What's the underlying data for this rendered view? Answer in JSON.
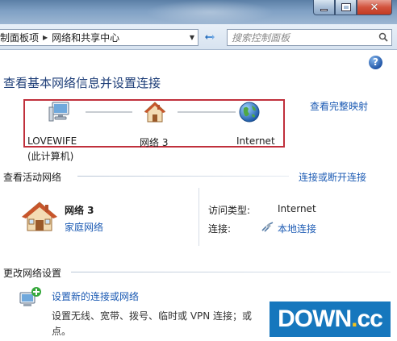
{
  "window": {
    "buttons": {
      "minimize": "minimize-icon",
      "maximize": "maximize-icon",
      "close": "close-icon"
    }
  },
  "address": {
    "crumbs": [
      "制面板项",
      "网络和共享中心"
    ],
    "refresh_icon": "refresh-icon",
    "search_placeholder": "搜索控制面板"
  },
  "main": {
    "title": "查看基本网络信息并设置连接",
    "view_full_map": "查看完整映射",
    "map": {
      "nodes": [
        {
          "label": "LOVEWIFE",
          "sublabel": "(此计算机)",
          "icon": "computer-icon"
        },
        {
          "label": "网络  3",
          "icon": "house-icon"
        },
        {
          "label": "Internet",
          "icon": "globe-icon"
        }
      ]
    },
    "active_networks": {
      "title": "查看活动网络",
      "connect_link": "连接或断开连接",
      "network": {
        "name": "网络  3",
        "type": "家庭网络",
        "icon": "house-icon",
        "access_type_label": "访问类型:",
        "access_type_value": "Internet",
        "connections_label": "连接:",
        "connections_value": "本地连接",
        "connection_icon": "ethernet-icon"
      }
    },
    "change_settings": {
      "title": "更改网络设置",
      "task": {
        "title": "设置新的连接或网络",
        "description": "设置无线、宽带、拨号、临时或 VPN 连接；或",
        "description_cont": "点。",
        "icon": "network-setup-icon"
      }
    }
  },
  "watermark": {
    "text": "DOWN",
    "dot": ".",
    "suffix": "cc"
  },
  "colors": {
    "title_blue": "#1e3e78",
    "link_blue": "#1b5ab3",
    "highlight_red": "#c0303c",
    "watermark_blue": "#1677bd",
    "watermark_yellow": "#f2c21b"
  }
}
